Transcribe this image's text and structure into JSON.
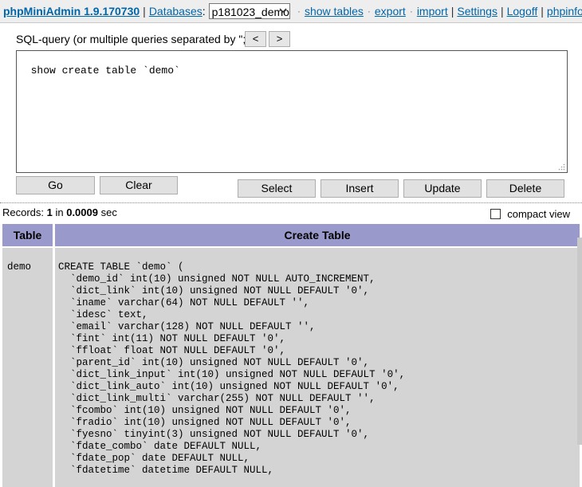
{
  "topbar": {
    "brand": "phpMiniAdmin 1.9.170730",
    "sep1": "|",
    "databases_label": "Databases",
    "colon": ":",
    "db_selected": "p181023_demo",
    "dot": "·",
    "links": [
      "show tables",
      "export",
      "import",
      "Settings",
      "Logoff",
      "phpinfo"
    ],
    "pipe": "|"
  },
  "query": {
    "label": "SQL-query (or multiple queries separated by \";\"):",
    "prev_label": "<",
    "next_label": ">",
    "sql_text": "show create table `demo`"
  },
  "buttons": {
    "go": "Go",
    "clear": "Clear",
    "select": "Select",
    "insert": "Insert",
    "update": "Update",
    "delete": "Delete"
  },
  "status": {
    "records_prefix": "Records: ",
    "records_count": "1",
    "in_text": " in ",
    "time": "0.0009",
    "sec_text": " sec",
    "compact_view": "compact view"
  },
  "results": {
    "columns": [
      "Table",
      "Create Table"
    ],
    "row": {
      "table": "demo",
      "create_table": "CREATE TABLE `demo` (\n  `demo_id` int(10) unsigned NOT NULL AUTO_INCREMENT,\n  `dict_link` int(10) unsigned NOT NULL DEFAULT '0',\n  `iname` varchar(64) NOT NULL DEFAULT '',\n  `idesc` text,\n  `email` varchar(128) NOT NULL DEFAULT '',\n  `fint` int(11) NOT NULL DEFAULT '0',\n  `ffloat` float NOT NULL DEFAULT '0',\n  `parent_id` int(10) unsigned NOT NULL DEFAULT '0',\n  `dict_link_input` int(10) unsigned NOT NULL DEFAULT '0',\n  `dict_link_auto` int(10) unsigned NOT NULL DEFAULT '0',\n  `dict_link_multi` varchar(255) NOT NULL DEFAULT '',\n  `fcombo` int(10) unsigned NOT NULL DEFAULT '0',\n  `fradio` int(10) unsigned NOT NULL DEFAULT '0',\n  `fyesno` tinyint(3) unsigned NOT NULL DEFAULT '0',\n  `fdate_combo` date DEFAULT NULL,\n  `fdate_pop` date DEFAULT NULL,\n  `fdatetime` datetime DEFAULT NULL,"
    }
  },
  "colors": {
    "link": "#0066aa",
    "header_bg": "#9999cc",
    "cell_bg": "#d4d4d4"
  }
}
